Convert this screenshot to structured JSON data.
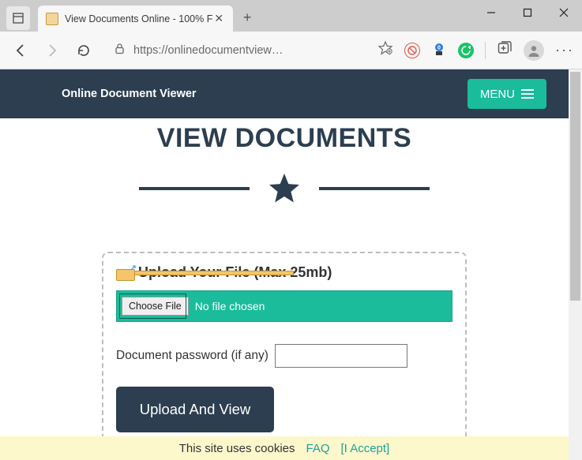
{
  "browser": {
    "tab_title": "View Documents Online - 100% F",
    "url_display": "https://onlinedocumentview…",
    "new_tab_label": "+"
  },
  "header": {
    "brand": "Online Document Viewer",
    "menu_label": "MENU"
  },
  "main": {
    "title": "VIEW DOCUMENTS"
  },
  "upload": {
    "heading": "Upload Your File (Max 25mb)",
    "choose_label": "Choose File",
    "file_status": "No file chosen",
    "password_label": "Document password (if any)",
    "password_value": "",
    "submit_label": "Upload And View"
  },
  "cookies": {
    "text": "This site uses cookies",
    "faq": "FAQ",
    "accept": "[I Accept]"
  },
  "colors": {
    "header_bg": "#2c3e50",
    "accent": "#1abc9c"
  }
}
